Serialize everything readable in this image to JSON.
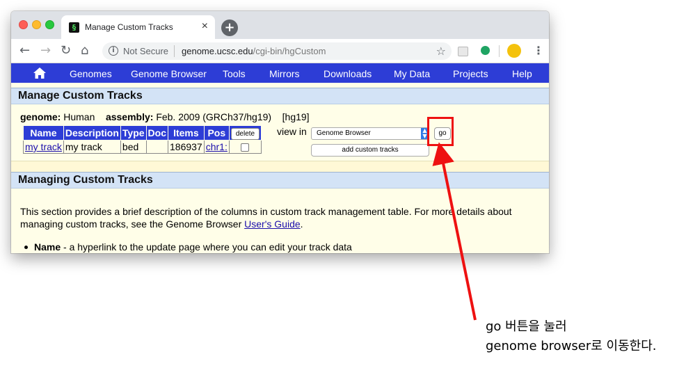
{
  "browser": {
    "tab_title": "Manage Custom Tracks",
    "tab_close": "×",
    "new_tab": "+",
    "back": "←",
    "forward": "→",
    "reload": "↻",
    "home": "⌂",
    "security_label": "Not Secure",
    "url_host": "genome.ucsc.edu",
    "url_path": "/cgi-bin/hgCustom",
    "star": "☆",
    "menu": "⋮"
  },
  "nav": {
    "items": [
      "Genomes",
      "Genome Browser",
      "Tools",
      "Mirrors",
      "Downloads",
      "My Data",
      "Projects",
      "Help"
    ]
  },
  "manage": {
    "heading": "Manage Custom Tracks",
    "genome_label": "genome:",
    "genome_value": "Human",
    "assembly_label": "assembly:",
    "assembly_value": "Feb. 2009 (GRCh37/hg19)",
    "db": "[hg19]",
    "columns": [
      "Name",
      "Description",
      "Type",
      "Doc",
      "Items",
      "Pos"
    ],
    "delete_label": "delete",
    "rows": [
      {
        "name": "my track",
        "description": "my track",
        "type": "bed",
        "doc": "",
        "items": "186937",
        "pos": "chr1:"
      }
    ],
    "view_in_label": "view in",
    "view_in_selected": "Genome Browser",
    "go_label": "go",
    "add_label": "add custom tracks"
  },
  "managing": {
    "heading": "Managing Custom Tracks",
    "intro": "This section provides a brief description of the columns in custom track management table. For more details about managing custom tracks, see the Genome Browser ",
    "guide_link": "User's Guide",
    "intro_end": ".",
    "bullet_term": "Name",
    "bullet_text": " - a hyperlink to the update page where you can edit your track data"
  },
  "annotation": {
    "line1": "go 버튼을 눌러",
    "line2": "genome browser로 이동한다.",
    "color": "#ee1111"
  }
}
